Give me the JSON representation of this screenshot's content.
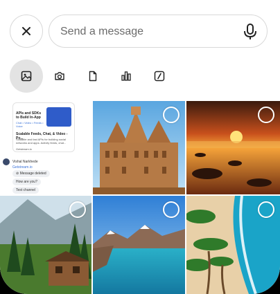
{
  "composer": {
    "close_icon": "close-icon",
    "placeholder": "Send a message",
    "mic_icon": "microphone-icon"
  },
  "attachment_tabs": [
    {
      "name": "gallery",
      "icon": "image-icon",
      "active": true
    },
    {
      "name": "camera",
      "icon": "camera-icon",
      "active": false
    },
    {
      "name": "files",
      "icon": "file-icon",
      "active": false
    },
    {
      "name": "poll",
      "icon": "bar-chart-icon",
      "active": false
    },
    {
      "name": "commands",
      "icon": "slash-command-icon",
      "active": false
    }
  ],
  "chat_screenshot": {
    "card_title": "APIs and SDKs to Build In-App",
    "card_subtitle": "Chat • Video • Feeds • Voice",
    "card_heading": "Scalable Feeds, Chat, & Video - Po...",
    "card_desc": "Scalable and fast APIs for building social networks and apps. Activity feeds, chat...",
    "card_link": "Getstream.io",
    "user_name": "Vishal Narkhede",
    "link_text": "Getstream.io",
    "deleted_text": "Message deleted",
    "bubble_1": "How are you?",
    "bubble_2": "Test channel"
  },
  "photos": [
    {
      "name": "chat-screenshot-thumbnail"
    },
    {
      "name": "temple-photo"
    },
    {
      "name": "sunset-beach-photo"
    },
    {
      "name": "mountain-cabin-photo"
    },
    {
      "name": "mountain-lake-photo"
    },
    {
      "name": "tropical-beach-photo"
    }
  ],
  "colors": {
    "active_tab_bg": "#e3e3e3",
    "border": "#d8d8d8",
    "placeholder": "#6b6b6b"
  }
}
